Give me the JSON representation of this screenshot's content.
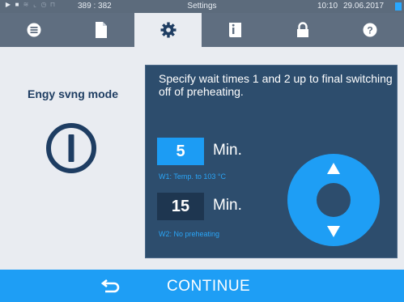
{
  "status_bar": {
    "coords": "389 : 382",
    "title": "Settings",
    "time": "10:10",
    "date": "29.06.2017",
    "icons": [
      "play-icon",
      "document-icon",
      "waves-icon",
      "chart-icon",
      "clock-icon",
      "lock-icon"
    ]
  },
  "tabs": [
    {
      "icon": "list-icon",
      "active": false
    },
    {
      "icon": "document-icon",
      "active": false
    },
    {
      "icon": "gear-icon",
      "active": true
    },
    {
      "icon": "info-book-icon",
      "active": false
    },
    {
      "icon": "lock-icon",
      "active": false
    },
    {
      "icon": "help-icon",
      "active": false
    }
  ],
  "mode": {
    "title": "Engy svng mode",
    "icon": "power-icon"
  },
  "dialog": {
    "message": "Specify wait times 1 and 2 up to final switching off of preheating.",
    "w1": {
      "value": "5",
      "unit": "Min.",
      "caption": "W1: Temp. to 103 °C"
    },
    "w2": {
      "value": "15",
      "unit": "Min.",
      "caption": "W2: No preheating"
    }
  },
  "footer": {
    "continue_label": "CONTINUE",
    "back_icon": "back-arrow-icon"
  },
  "colors": {
    "accent": "#1e9ef5",
    "dialog_bg": "#2d4d6d",
    "tab_bar": "#5f6e80",
    "dark_navy": "#1e3d62"
  }
}
